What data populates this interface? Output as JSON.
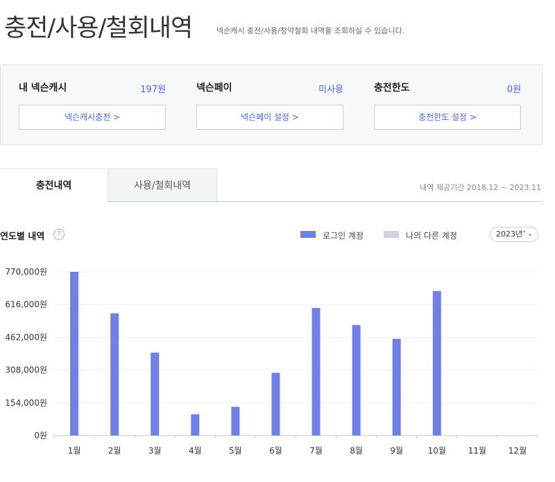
{
  "page": {
    "title": "충전/사용/철회내역",
    "description": "넥슨캐시 충전/사용/청약철회 내역을 조회하실 수 있습니다."
  },
  "summary": [
    {
      "label": "내 넥슨캐시",
      "value": "197원",
      "button": "넥슨캐시충전 >"
    },
    {
      "label": "넥슨페이",
      "value": "미사용",
      "button": "넥슨페이 설정 >"
    },
    {
      "label": "충전한도",
      "value": "0원",
      "button": "충전한도 설정 >"
    }
  ],
  "tabs": [
    {
      "label": "충전내역",
      "active": true
    },
    {
      "label": "사용/철회내역",
      "active": false
    }
  ],
  "period_text": "내역 제공기간 2018.12 ~ 2023.11",
  "section": {
    "title": "연도별 내역",
    "help_icon": "help-circle-icon"
  },
  "legend": [
    {
      "label": "로그인 계정",
      "color": "#7180e6"
    },
    {
      "label": "나의 다른 계정",
      "color": "#d3d4e2"
    }
  ],
  "year_select": {
    "value": "2023년",
    "icon": "chevron-updown-icon"
  },
  "chart_data": {
    "type": "bar",
    "categories": [
      "1월",
      "2월",
      "3월",
      "4월",
      "5월",
      "6월",
      "7월",
      "8월",
      "9월",
      "10월",
      "11월",
      "12월"
    ],
    "series": [
      {
        "name": "로그인 계정",
        "color": "#7180e6",
        "values": [
          770000,
          575000,
          390000,
          100000,
          135000,
          295000,
          600000,
          520000,
          455000,
          680000,
          0,
          0
        ]
      }
    ],
    "y_ticks": [
      0,
      154000,
      308000,
      462000,
      616000,
      770000
    ],
    "y_tick_labels": [
      "0원",
      "154,000원",
      "308,000원",
      "462,000원",
      "616,000원",
      "770,000원"
    ],
    "ylim": [
      0,
      770000
    ],
    "grid": true
  }
}
